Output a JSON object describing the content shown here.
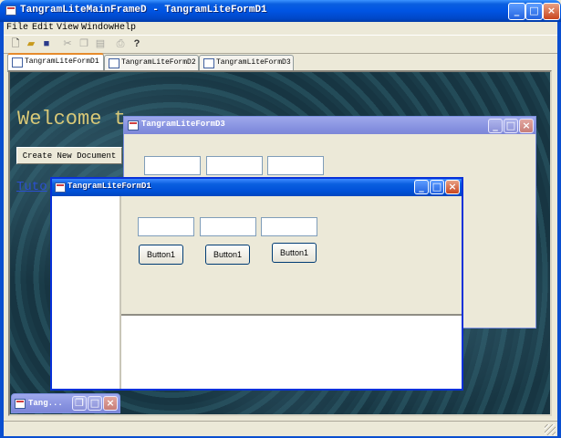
{
  "app": {
    "title": "TangramLiteMainFrameD - TangramLiteFormD1"
  },
  "menu": [
    "File",
    "Edit",
    "View",
    "Window",
    "Help"
  ],
  "toolbar": {
    "icons": [
      "new-icon",
      "open-icon",
      "save-icon",
      "cut-icon",
      "copy-icon",
      "paste-icon",
      "print-icon",
      "help-icon"
    ]
  },
  "tabs": [
    {
      "label": "TangramLiteFormD1",
      "active": true
    },
    {
      "label": "TangramLiteFormD2",
      "active": false
    },
    {
      "label": "TangramLiteFormD3",
      "active": false
    }
  ],
  "background_page": {
    "welcome": "Welcome t",
    "create_button": "Create New Document",
    "link_text": "Tuto"
  },
  "form_d3": {
    "title": "TangramLiteFormD3"
  },
  "form_d1": {
    "title": "TangramLiteFormD1",
    "buttons": [
      "Button1",
      "Button1",
      "Button1"
    ]
  },
  "minimized": {
    "title": "Tang..."
  },
  "colors": {
    "title_active": "#0054e3",
    "title_inactive": "#8792e0",
    "welcome_text": "#d8c877",
    "tab_accent": "#e68b2c"
  }
}
